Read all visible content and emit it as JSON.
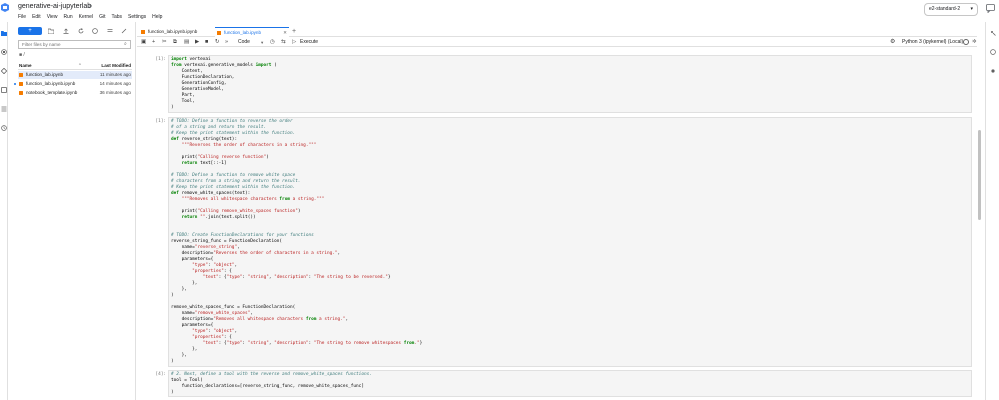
{
  "app": {
    "title": "generative-ai-jupyterlab",
    "menu": [
      "File",
      "Edit",
      "View",
      "Run",
      "Kernel",
      "Git",
      "Tabs",
      "Settings",
      "Help"
    ],
    "machine_type": "e2-standard-2"
  },
  "file_browser": {
    "new_label": "+",
    "filter_placeholder": "Filter files by name",
    "breadcrumb": "/",
    "col_name": "Name",
    "col_modified": "Last Modified",
    "files": [
      {
        "name": "function_lab.ipynb",
        "modified": "11 minutes ago",
        "selected": true,
        "running": false
      },
      {
        "name": "function_lab.ipynb.ipynb",
        "modified": "14 minutes ago",
        "selected": false,
        "running": true
      },
      {
        "name": "notebook_template.ipynb",
        "modified": "36 minutes ago",
        "selected": false,
        "running": false
      }
    ]
  },
  "tabs": [
    {
      "label": "function_lab.ipynb.ipynb",
      "active": false
    },
    {
      "label": "function_lab.ipynb",
      "active": true
    }
  ],
  "notebook_toolbar": {
    "cell_type": "Code",
    "execute_label": "Execute",
    "kernel": "Python 3 (ipykernel) (Local)"
  },
  "cells": [
    {
      "prompt": "[1]:",
      "lines": [
        "import vertexai",
        "from vertexai.generative_models import (",
        "    Content,",
        "    FunctionDeclaration,",
        "    GenerationConfig,",
        "    GenerativeModel,",
        "    Part,",
        "    Tool,",
        ")"
      ]
    },
    {
      "prompt": "[1]:",
      "lines": [
        "# TODO: Define a function to reverse the order",
        "# of a string and return the result.",
        "# Keep the print statement within the function.",
        "def reverse_string(text):",
        "    \"\"\"Reverses the order of characters in a string.\"\"\"",
        "",
        "    print(\"Calling reverse function\")",
        "    return text[::-1]",
        "",
        "# TODO: Define a function to remove white space",
        "# characters from a string and return the result.",
        "# Keep the print statement within the function.",
        "def remove_white_spaces(text):",
        "    \"\"\"Removes all whitespace characters from a string.\"\"\"",
        "",
        "    print(\"Calling remove_white_spaces function\")",
        "    return \"\".join(text.split())",
        "",
        "",
        "# TODO: Create FunctionDeclarations for your functions",
        "reverse_string_func = FunctionDeclaration(",
        "    name=\"reverse_string\",",
        "    description=\"Reverses the order of characters in a string.\",",
        "    parameters={",
        "        \"type\": \"object\",",
        "        \"properties\": {",
        "            \"text\": {\"type\": \"string\", \"description\": \"The string to be reversed.\"}",
        "        },",
        "    },",
        ")",
        "",
        "remove_white_spaces_func = FunctionDeclaration(",
        "    name=\"remove_white_spaces\",",
        "    description=\"Removes all whitespace characters from a string.\",",
        "    parameters={",
        "        \"type\": \"object\",",
        "        \"properties\": {",
        "            \"text\": {\"type\": \"string\", \"description\": \"The string to remove whitespaces from.\"}",
        "        },",
        "    },",
        ")"
      ]
    },
    {
      "prompt": "[4]:",
      "lines": [
        "# 2. Next, define a tool with the reverse and remove_white_spaces functions.",
        "tool = Tool(",
        "    function_declarations=[reverse_string_func, remove_white_spaces_func]",
        ")"
      ]
    }
  ]
}
